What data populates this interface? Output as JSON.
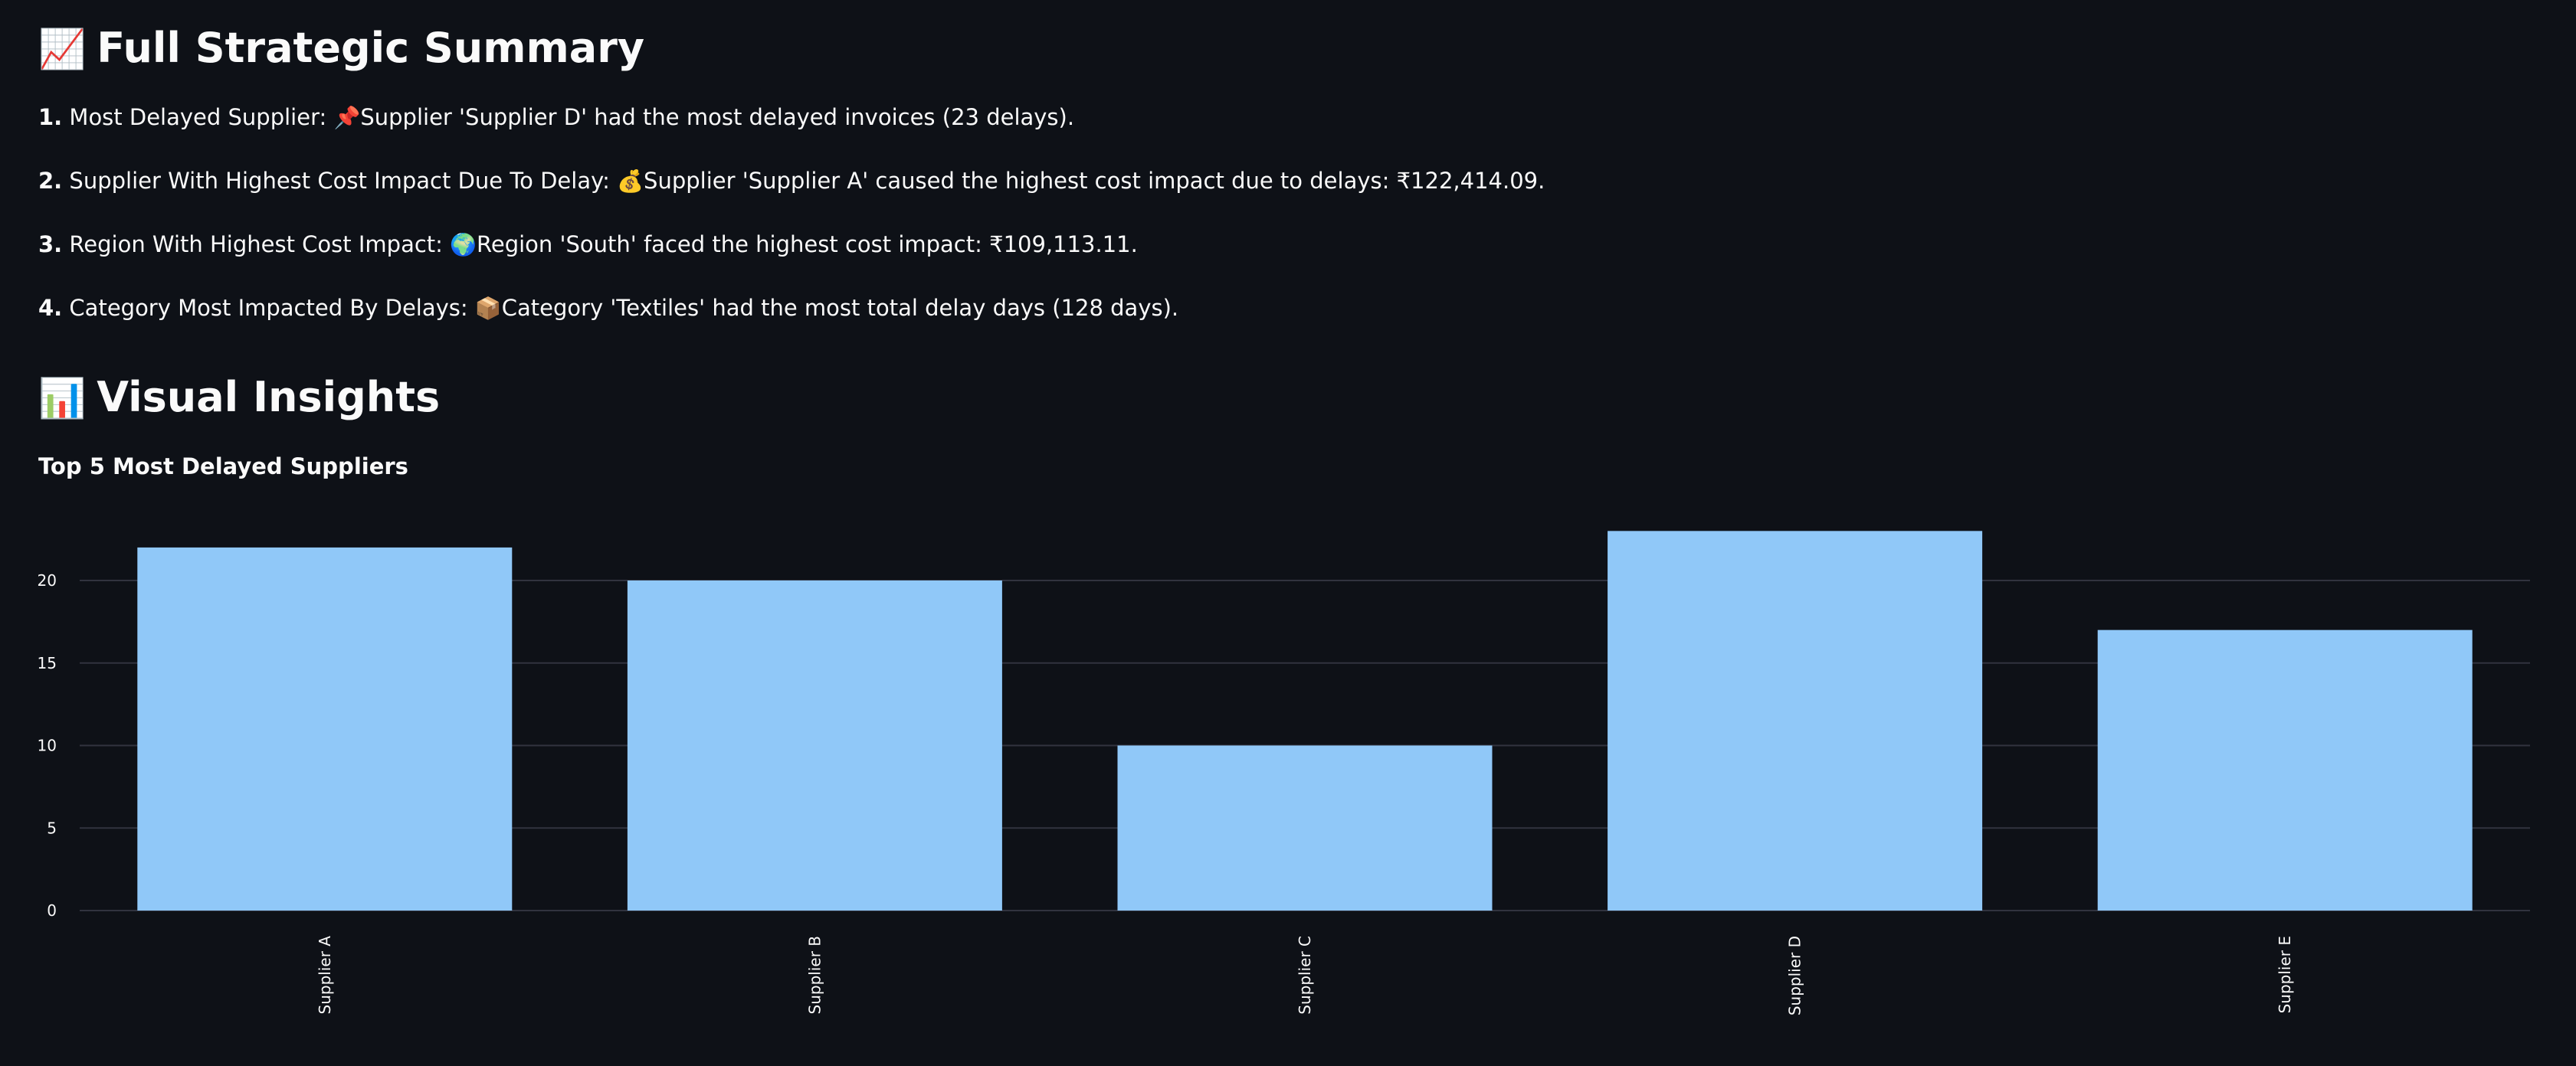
{
  "summary": {
    "title": "Full Strategic Summary",
    "title_icon": "chart-increasing-icon",
    "items": [
      {
        "number": "1.",
        "label": "Most Delayed Supplier:",
        "icon": "pushpin-icon",
        "text": "Supplier 'Supplier D' had the most delayed invoices (23 delays)."
      },
      {
        "number": "2.",
        "label": "Supplier With Highest Cost Impact Due To Delay:",
        "icon": "money-bag-icon",
        "text": "Supplier 'Supplier A' caused the highest cost impact due to delays: ₹122,414.09."
      },
      {
        "number": "3.",
        "label": "Region With Highest Cost Impact:",
        "icon": "globe-icon",
        "text": "Region 'South' faced the highest cost impact: ₹109,113.11."
      },
      {
        "number": "4.",
        "label": "Category Most Impacted By Delays:",
        "icon": "package-icon",
        "text": "Category 'Textiles' had the most total delay days (128 days)."
      }
    ]
  },
  "visual": {
    "title": "Visual Insights",
    "title_icon": "bar-chart-icon"
  },
  "chart_data": {
    "type": "bar",
    "title": "Top 5 Most Delayed Suppliers",
    "categories": [
      "Supplier A",
      "Supplier B",
      "Supplier C",
      "Supplier D",
      "Supplier E"
    ],
    "values": [
      22,
      20,
      10,
      23,
      17
    ],
    "xlabel": "",
    "ylabel": "",
    "ylim": [
      0,
      23
    ],
    "yticks": [
      0,
      5,
      10,
      15,
      20
    ],
    "grid": true,
    "bar_color": "#90c8f8",
    "grid_color": "#31333f"
  },
  "colors": {
    "background": "#0e1117",
    "text": "#fafafa"
  }
}
